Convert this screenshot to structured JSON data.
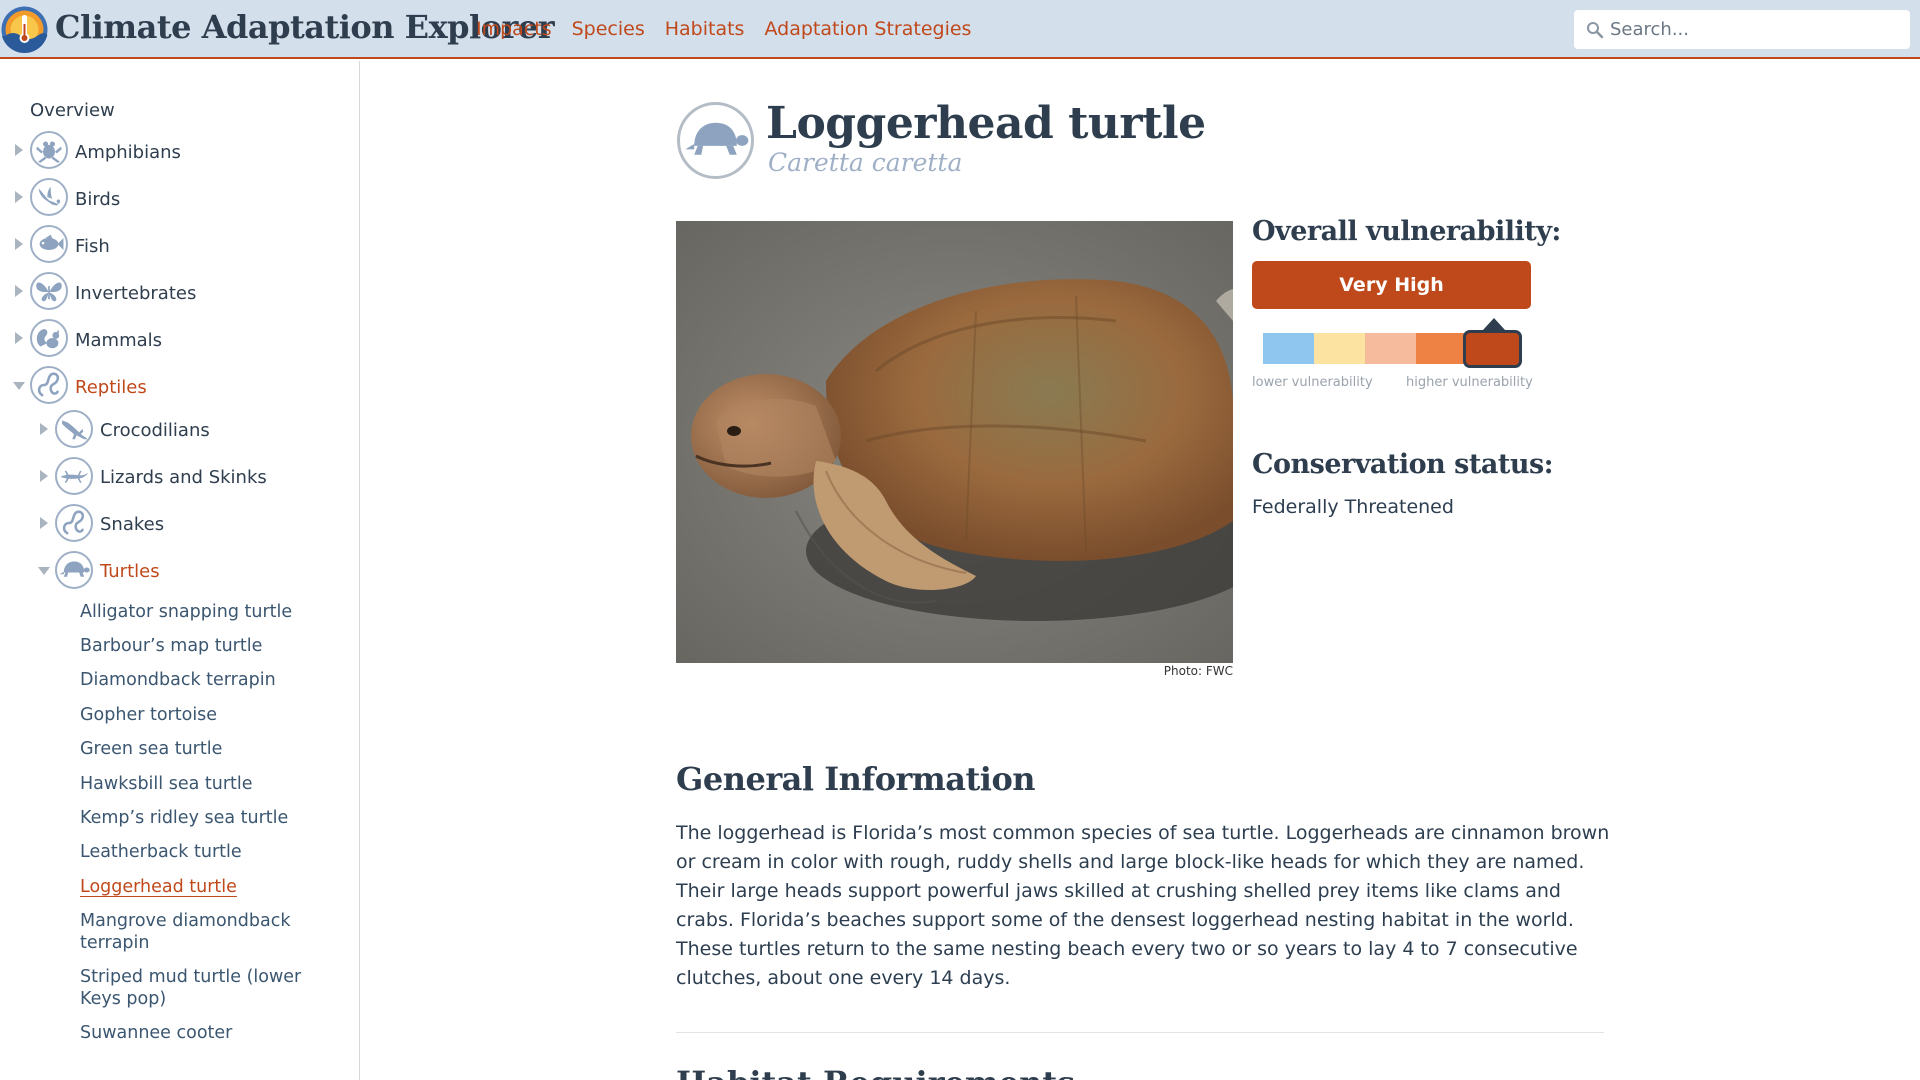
{
  "header": {
    "app_title": "Climate Adaptation Explorer",
    "nav": [
      "Impacts",
      "Species",
      "Habitats",
      "Adaptation Strategies"
    ],
    "search_placeholder": "Search...",
    "accent_color": "#c0491b",
    "bar_color": "#d4dfec"
  },
  "sidebar": {
    "overview": "Overview",
    "categories": [
      {
        "label": "Amphibians",
        "icon": "frog-icon",
        "expanded": false
      },
      {
        "label": "Birds",
        "icon": "bird-icon",
        "expanded": false
      },
      {
        "label": "Fish",
        "icon": "fish-icon",
        "expanded": false
      },
      {
        "label": "Invertebrates",
        "icon": "butterfly-icon",
        "expanded": false
      },
      {
        "label": "Mammals",
        "icon": "squirrel-icon",
        "expanded": false
      },
      {
        "label": "Reptiles",
        "icon": "snake-icon",
        "expanded": true
      }
    ],
    "subcategories": [
      {
        "label": "Crocodilians",
        "icon": "crocodile-icon",
        "expanded": false
      },
      {
        "label": "Lizards and Skinks",
        "icon": "lizard-icon",
        "expanded": false
      },
      {
        "label": "Snakes",
        "icon": "snake-icon",
        "expanded": false
      },
      {
        "label": "Turtles",
        "icon": "turtle-icon",
        "expanded": true
      }
    ],
    "species": [
      "Alligator snapping turtle",
      "Barbour’s map turtle",
      "Diamondback terrapin",
      "Gopher tortoise",
      "Green sea turtle",
      "Hawksbill sea turtle",
      "Kemp’s ridley sea turtle",
      "Leatherback turtle",
      "Loggerhead turtle",
      "Mangrove diamondback terrapin",
      "Striped mud turtle (lower Keys pop)",
      "Suwannee cooter"
    ],
    "current_species": "Loggerhead turtle"
  },
  "species": {
    "common_name": "Loggerhead turtle",
    "scientific_name": "Caretta caretta",
    "icon": "turtle-icon",
    "photo_credit": "Photo: FWC",
    "vulnerability": {
      "heading": "Overall vulnerability:",
      "level": "Very High",
      "scale_index": 4,
      "scale_colors": [
        "#8ec6f0",
        "#fce3a2",
        "#f5bb9c",
        "#ee8144",
        "#c0491b"
      ],
      "low_label": "lower vulnerability",
      "high_label": "higher vulnerability"
    },
    "conservation": {
      "heading": "Conservation status:",
      "status": "Federally Threatened"
    }
  },
  "general": {
    "heading": "General Information",
    "text": "The loggerhead is Florida’s most common species of sea turtle. Loggerheads are cinnamon brown or cream in color with rough, ruddy shells and large block-like heads for which they are named. Their large heads support powerful jaws skilled at crushing shelled prey items like clams and crabs. Florida’s beaches support some of the densest loggerhead nesting habitat in the world. These turtles return to the same nesting beach every two or so years to lay 4 to 7 consecutive clutches, about one every 14 days."
  },
  "next_section": {
    "heading": "Habitat Requirements"
  }
}
